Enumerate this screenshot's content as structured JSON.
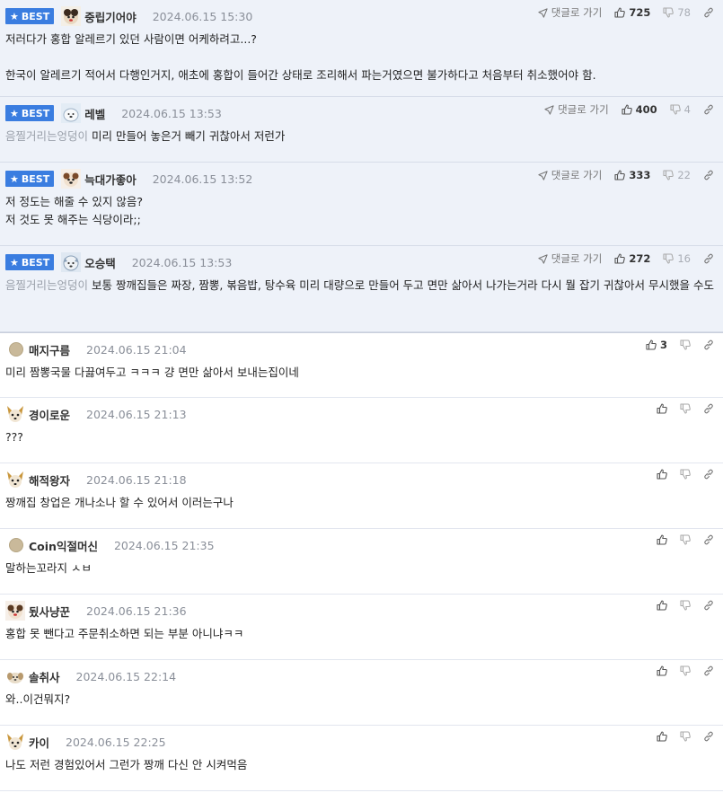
{
  "reply_label": "댓글로 가기",
  "best_label": "BEST",
  "comments": [
    {
      "best": true,
      "nick": "중립기어야",
      "date": "2024.06.15 15:30",
      "up": "725",
      "down": "78",
      "mention": "",
      "text": "저러다가 홍합 알레르기 있던 사람이면 어케하려고...?\n\n한국이 알레르기 적어서 다행인거지, 애초에 홍합이 들어간 상태로 조리해서 파는거였으면 불가하다고 처음부터 취소했어야 함."
    },
    {
      "best": true,
      "nick": "레벨",
      "date": "2024.06.15 13:53",
      "up": "400",
      "down": "4",
      "mention": "음찔거리는엉덩이",
      "text": "미리 만들어 놓은거 빼기 귀찮아서 저런가"
    },
    {
      "best": true,
      "nick": "늑대가좋아",
      "date": "2024.06.15 13:52",
      "up": "333",
      "down": "22",
      "mention": "",
      "text": "저 정도는 해줄 수 있지 않음?\n저 것도 못 해주는 식당이라;;"
    },
    {
      "best": true,
      "nick": "오승택",
      "date": "2024.06.15 13:53",
      "up": "272",
      "down": "16",
      "mention": "음찔거리는엉덩이",
      "text": "보통 짱깨집들은 짜장, 짬뽕, 볶음밥, 탕수육 미리 대량으로 만들어 두고 면만 삶아서 나가는거라 다시 뭘 잡기 귀찮아서 무시했을 수도"
    },
    {
      "best": false,
      "nick": "매지구름",
      "date": "2024.06.15 21:04",
      "up": "3",
      "down": "",
      "mention": "",
      "text": "미리 짬뽕국물 다끓여두고 ㅋㅋㅋ 걍 면만 삶아서 보내는집이네"
    },
    {
      "best": false,
      "nick": "경이로운",
      "date": "2024.06.15 21:13",
      "up": "",
      "down": "",
      "mention": "",
      "text": "???"
    },
    {
      "best": false,
      "nick": "해적왕자",
      "date": "2024.06.15 21:18",
      "up": "",
      "down": "",
      "mention": "",
      "text": "짱깨집 창업은 개나소나 할 수 있어서 이러는구나"
    },
    {
      "best": false,
      "nick": "Coin익절머신",
      "date": "2024.06.15 21:35",
      "up": "",
      "down": "",
      "mention": "",
      "text": "말하는꼬라지 ㅅㅂ"
    },
    {
      "best": false,
      "nick": "됬사냥꾼",
      "date": "2024.06.15 21:36",
      "up": "",
      "down": "",
      "mention": "",
      "text": "홍합 못 뺀다고 주문취소하면 되는 부분 아니냐ㅋㅋ"
    },
    {
      "best": false,
      "nick": "솔취사",
      "date": "2024.06.15 22:14",
      "up": "",
      "down": "",
      "mention": "",
      "text": "와..이건뭐지?"
    },
    {
      "best": false,
      "nick": "카이",
      "date": "2024.06.15 22:25",
      "up": "",
      "down": "",
      "mention": "",
      "text": "나도 저런 경험있어서 그런가 짱깨 다신 안 시켜먹음"
    }
  ]
}
